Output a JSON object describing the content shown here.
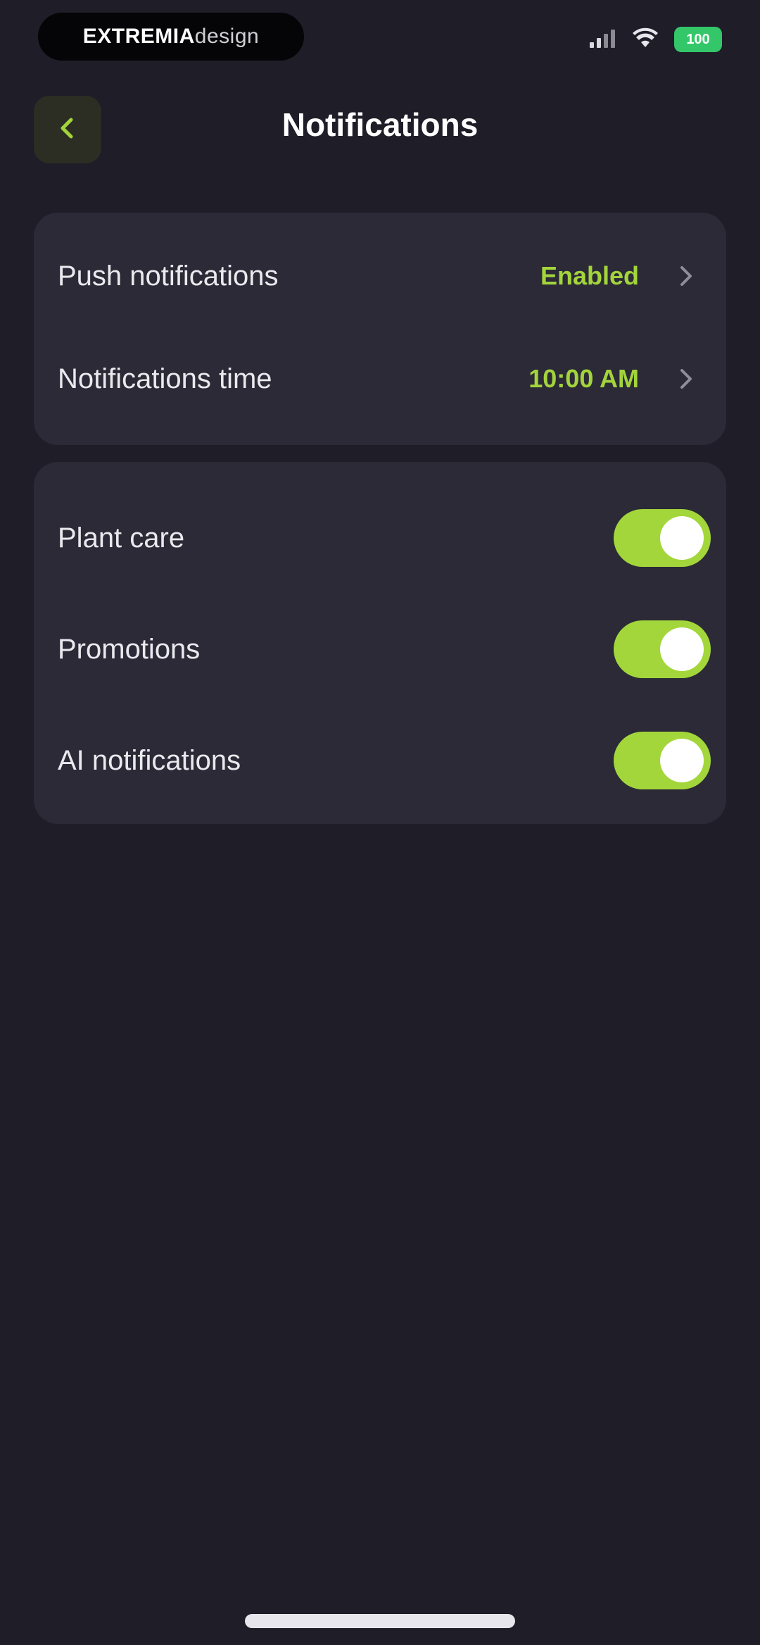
{
  "status_bar": {
    "brand_bold": "EXTREMIA",
    "brand_light": "design",
    "battery": "100"
  },
  "header": {
    "title": "Notifications"
  },
  "settings_card": {
    "rows": [
      {
        "label": "Push notifications",
        "value": "Enabled"
      },
      {
        "label": "Notifications time",
        "value": "10:00 AM"
      }
    ]
  },
  "toggles_card": {
    "rows": [
      {
        "label": "Plant care",
        "enabled": true
      },
      {
        "label": "Promotions",
        "enabled": true
      },
      {
        "label": "AI notifications",
        "enabled": true
      }
    ]
  },
  "colors": {
    "background": "#1e1d28",
    "card": "#2b2a36",
    "accent": "#a3d43c",
    "battery": "#34c76a"
  }
}
